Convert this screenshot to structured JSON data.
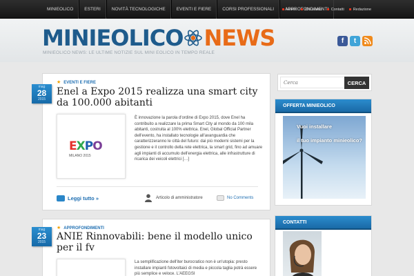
{
  "topnav": {
    "items": [
      "MINIEOLICO",
      "ESTERI",
      "NOVITÀ TECNOLOGICHE",
      "EVENTI E FIERE",
      "CORSI PROFESSIONALI",
      "APPROFONDIMENTI"
    ],
    "secondary": [
      "Home",
      "Chi siamo",
      "Contatti",
      "Redazione"
    ]
  },
  "header": {
    "logo_part1": "MINIEOLICO",
    "logo_part2": "NEWS",
    "tagline": "MINIEOLICO NEWS: LE ULTIME NOTIZIE SUL MINI EOLICO IN TEMPO REALE",
    "social": {
      "facebook": "f",
      "twitter": "t",
      "rss": "rss-icon"
    }
  },
  "posts": [
    {
      "month": "mag",
      "day": "28",
      "year": "2015",
      "category": "EVENTI E FIERE",
      "title": "Enel a Expo 2015 realizza una smart city da 100.000 abitanti",
      "thumb_letters": [
        "E",
        "X",
        "P",
        "O"
      ],
      "thumb_caption": "MILANO 2015",
      "excerpt": "È innovazione la parola d'ordine di Expo 2015, dove Enel ha contribuito a realizzare la prima Smart City al mondo da 100 mila abitanti, costruita al 100% elettrica. Enel, Global Official Partner dell'evento, ha installato tecnologie all'avanguardia che caratterizzeranno le città del futuro: dai più moderni sistemi per la gestione e il controllo della rete elettrica, la smart grid, fino ad amuare agli impianti di accumulo dell'energia elettrica, alle infrastrutture di ricarica dei veicoli elettrici […]",
      "read_more": "Leggi tutto »",
      "author": "Articolo di amministratore",
      "comments": "No Comments"
    },
    {
      "month": "mag",
      "day": "23",
      "year": "2015",
      "category": "APPROFONDIMENTI",
      "title": "ANIE Rinnovabili: bene il modello unico per il fv",
      "excerpt": "La semplificazione dell'iter burocratico non è un'utopia: presto installare impianti fotovoltaici di media e piccola taglia potrà essere più semplice e veloce. L'AEEGSI"
    }
  ],
  "sidebar": {
    "search_placeholder": "Cerca",
    "search_button": "CERCA",
    "widget1_title": "OFFERTA MINIEOLICO",
    "ad_line1": "Vuoi installare",
    "ad_line2": "il tuo impianto minieolico?",
    "widget2_title": "CONTATTI"
  },
  "colors": {
    "accent": "#1f6fb2",
    "logo_blue": "#1e5b8c",
    "logo_orange": "#e86b18",
    "nav_bg": "#1e1e1e"
  }
}
